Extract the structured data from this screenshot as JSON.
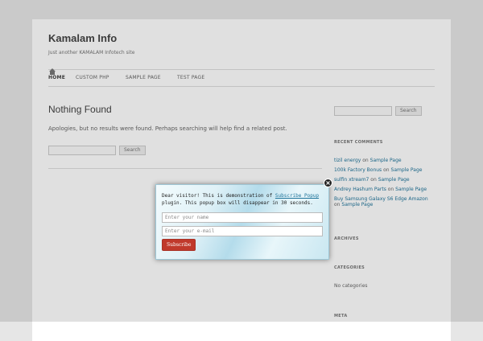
{
  "site": {
    "title": "Kamalam Info",
    "description": "Just another KAMALAM Infotech site"
  },
  "nav": {
    "items": [
      {
        "label": "Home",
        "current": true
      },
      {
        "label": "Custom PHP"
      },
      {
        "label": "Sample Page"
      },
      {
        "label": "Test Page"
      }
    ]
  },
  "content": {
    "title": "Nothing Found",
    "message": "Apologies, but no results were found. Perhaps searching will help find a related post.",
    "search_button": "Search"
  },
  "sidebar": {
    "search_button": "Search",
    "recent_comments_title": "Recent Comments",
    "comments": [
      {
        "author": "tizil energy",
        "on": "on",
        "post": "Sample Page"
      },
      {
        "author": "100k Factory Bonus",
        "on": "on",
        "post": "Sample Page"
      },
      {
        "author": "sulfin xtream7",
        "on": "on",
        "post": "Sample Page"
      },
      {
        "author": "Andrey Hashum Parts",
        "on": "on",
        "post": "Sample Page"
      },
      {
        "author": "Buy Samsung Galaxy S6 Edge Amazon",
        "on": "on",
        "post": "Sample Page"
      }
    ],
    "archives_title": "Archives",
    "categories_title": "Categories",
    "no_categories": "No categories",
    "meta_title": "Meta"
  },
  "popup": {
    "message_pre": "Dear visitor! This is demonstration of ",
    "message_link": "Subscribe Popup",
    "message_post": " plugin. This popup box will disappear in 30 seconds.",
    "name_placeholder": "Enter your name",
    "email_placeholder": "Enter your e-mail",
    "subscribe_label": "Subscribe",
    "accent_color": "#c0392b"
  }
}
